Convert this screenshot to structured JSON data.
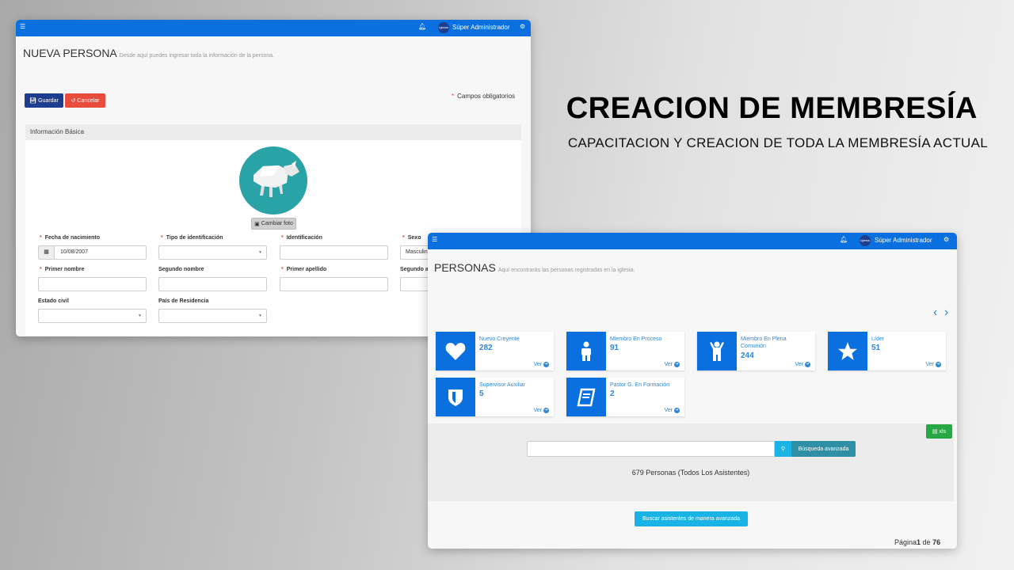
{
  "slide": {
    "headline": "CREACION DE MEMBRESÍA",
    "subline": "CAPACITACION Y CREACION DE TODA LA MEMBRESÍA ACTUAL"
  },
  "topbar": {
    "menu_icon": "hamburger-icon",
    "avatar_text": "Iglesia",
    "user_name": "Súper Administrador"
  },
  "nueva_persona": {
    "title": "NUEVA PERSONA",
    "subtitle": "Desde aquí puedes ingresar toda la información de la persona.",
    "save_label": "Guardar",
    "cancel_label": "Cancelar",
    "required_mark": "*",
    "required_note": "Campos obligatorios",
    "panel_title": "Información Básica",
    "change_photo_label": "Cambiar foto",
    "fields": {
      "birthdate_label": "Fecha de nacimiento",
      "birthdate_value": "10/08/2007",
      "id_type_label": "Tipo de identificación",
      "id_label": "Identificación",
      "sex_label": "Sexo",
      "sex_value": "Masculino",
      "first_name_label": "Primer nombre",
      "second_name_label": "Segundo nombre",
      "first_surname_label": "Primer apellido",
      "second_surname_label": "Segundo apellido",
      "civil_status_label": "Estado civil",
      "country_label": "País de Residencia"
    }
  },
  "personas": {
    "title": "PERSONAS",
    "subtitle": "Aquí encontrarás las personas registradas en la iglesia.",
    "cards": [
      {
        "name": "Nuevo Creyente",
        "count": "282",
        "link": "Ver",
        "icon": "heart-icon"
      },
      {
        "name": "Miembro En Proceso",
        "count": "91",
        "link": "Ver",
        "icon": "person-icon"
      },
      {
        "name": "Miembro En Plena Comunión",
        "count": "244",
        "link": "Ver",
        "icon": "person-arms-up-icon"
      },
      {
        "name": "Líder",
        "count": "51",
        "link": "Ver",
        "icon": "star-icon"
      },
      {
        "name": "Supervisor Auxiliar",
        "count": "5",
        "link": "Ver",
        "icon": "shield-icon"
      },
      {
        "name": "Pastor G. En Formación",
        "count": "2",
        "link": "Ver",
        "icon": "book-icon"
      }
    ],
    "xls_label": "xls",
    "search_placeholder": "",
    "advanced_search_label": "Búsqueda avanzada",
    "total_text": "679 Personas (Todos Los Asistentes)",
    "advanced_button_label": "Buscar asistentes de manera avanzada",
    "pagination": {
      "prefix": "Página",
      "current": "1",
      "separator": " de ",
      "total": "76"
    }
  },
  "colors": {
    "primary": "#0a6fdf",
    "save": "#1d3d8f",
    "cancel": "#e74c3c",
    "xls": "#28a745",
    "advanced": "#1ab3e6"
  }
}
